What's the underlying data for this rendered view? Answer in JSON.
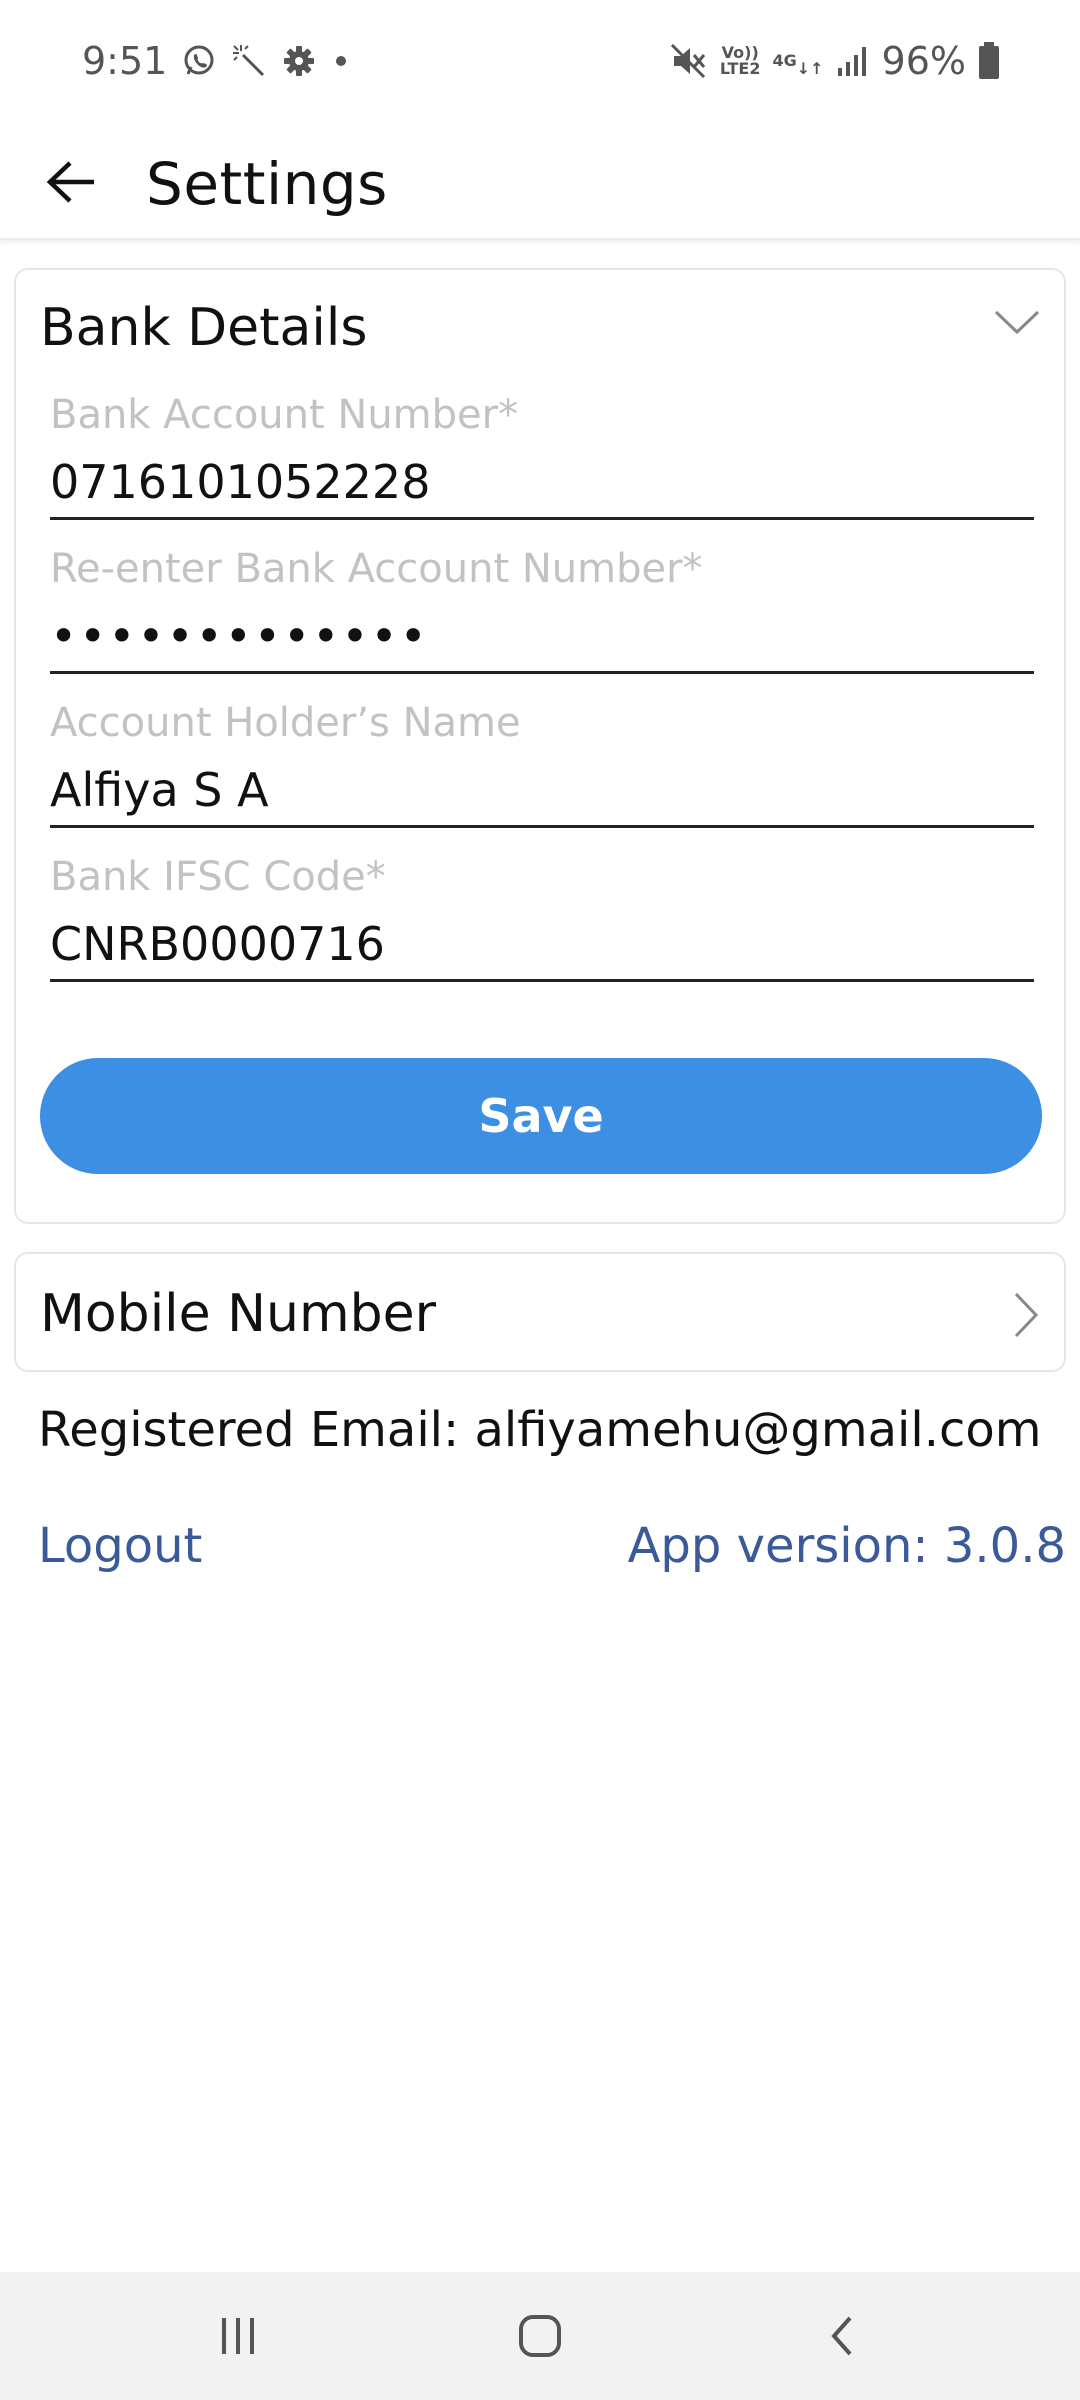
{
  "status_bar": {
    "time": "9:51",
    "battery": "96%",
    "volte_label": "Vo))\nLTE2",
    "network_label": "4G",
    "left_icons": [
      "whatsapp-icon",
      "magic-wand-icon",
      "settings-gear-icon",
      "dot-icon"
    ],
    "right_icons": [
      "mute-icon",
      "volte-icon",
      "4g-data-icon",
      "signal-icon",
      "battery-icon"
    ]
  },
  "header": {
    "title": "Settings",
    "back_icon": "arrow-left-icon"
  },
  "bank_details": {
    "title": "Bank Details",
    "collapse_icon": "chevron-down-icon",
    "account_number": {
      "label": "Bank Account Number*",
      "value": "0716101052228"
    },
    "reenter_account_number": {
      "label": "Re-enter Bank Account Number*",
      "value": "•••••••••••••"
    },
    "holder_name": {
      "label": "Account Holder’s Name",
      "value": "Alfiya S A"
    },
    "ifsc": {
      "label": "Bank IFSC Code*",
      "value": "CNRB0000716"
    },
    "save_label": "Save"
  },
  "mobile_number": {
    "title": "Mobile Number",
    "icon": "chevron-right-icon"
  },
  "registered_email": {
    "label": "Registered Email:",
    "value": "alfiyamehu@gmail.com"
  },
  "footer": {
    "logout_label": "Logout",
    "app_version": "App version: 3.0.8"
  },
  "nav_bar": {
    "icons": [
      "recent-apps-icon",
      "home-icon",
      "back-icon"
    ]
  },
  "colors": {
    "accent": "#3d8fe3",
    "link": "#3a5a9a",
    "label_gray": "#c2c2c2"
  }
}
